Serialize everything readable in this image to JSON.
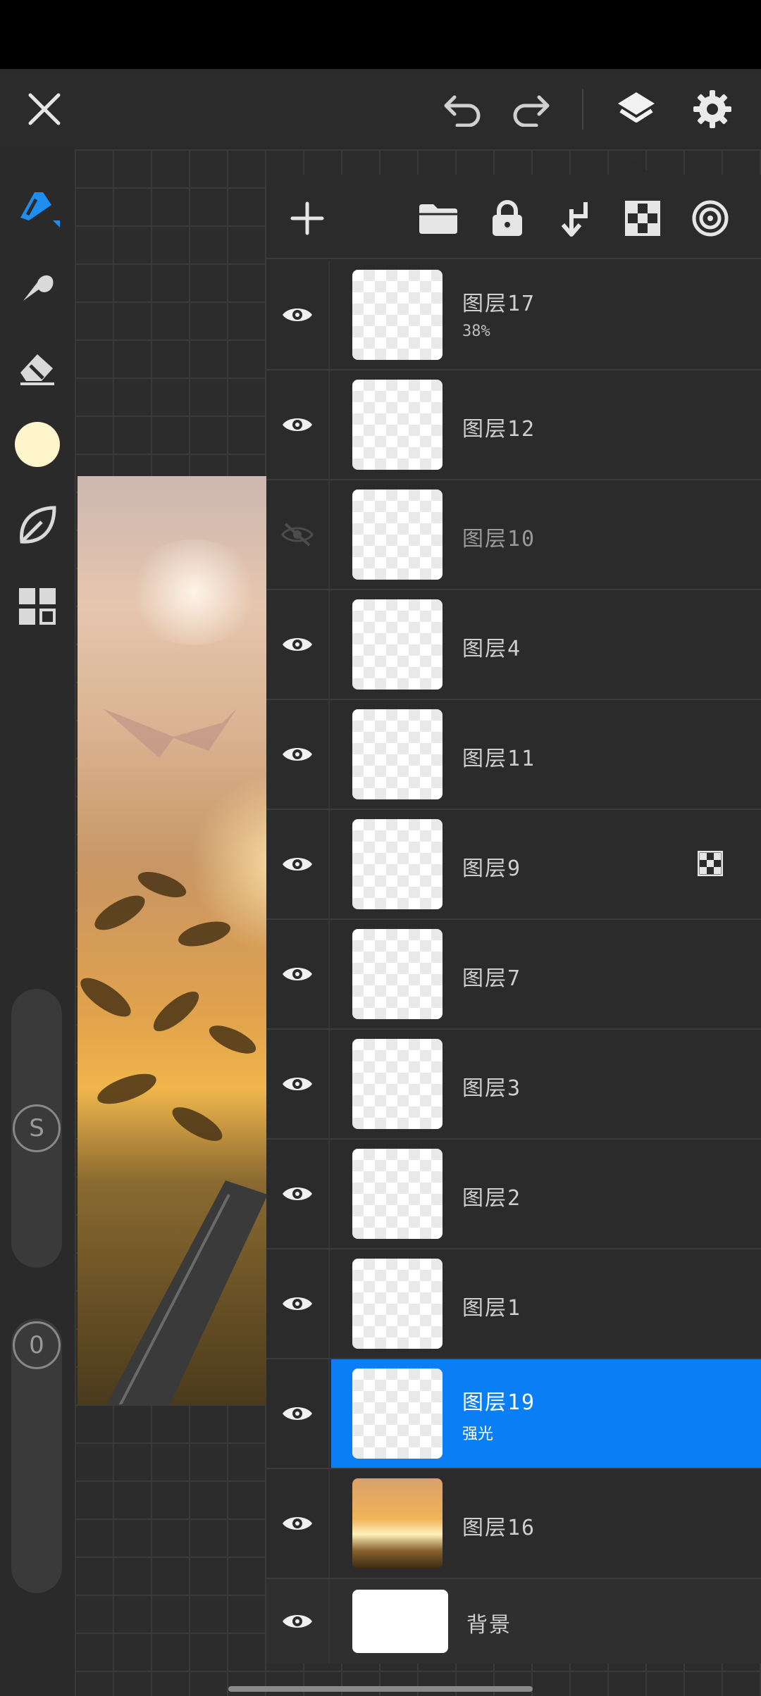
{
  "toolbar": {
    "close_icon": "close-icon",
    "undo_icon": "undo-icon",
    "redo_icon": "redo-icon",
    "layers_icon": "layers-icon",
    "settings_icon": "gear-icon"
  },
  "sidebar": {
    "tools": [
      "brush-tool",
      "smudge-tool",
      "eraser-tool",
      "color-picker",
      "selection-tool",
      "gallery-grid"
    ],
    "active_color": "#fff5cc",
    "size_slider_label": "S",
    "opacity_slider_label": "0"
  },
  "panel_toolbar": {
    "icons": [
      "add-layer-icon",
      "folder-icon",
      "lock-icon",
      "merge-down-icon",
      "alpha-lock-icon",
      "reference-icon"
    ]
  },
  "layers": [
    {
      "name": "图层17",
      "sub": "38%",
      "visible": true
    },
    {
      "name": "图层12",
      "sub": "",
      "visible": true
    },
    {
      "name": "图层10",
      "sub": "",
      "visible": false
    },
    {
      "name": "图层4",
      "sub": "",
      "visible": true
    },
    {
      "name": "图层11",
      "sub": "",
      "visible": true
    },
    {
      "name": "图层9",
      "sub": "",
      "visible": true,
      "alpha_locked": true
    },
    {
      "name": "图层7",
      "sub": "",
      "visible": true
    },
    {
      "name": "图层3",
      "sub": "",
      "visible": true
    },
    {
      "name": "图层2",
      "sub": "",
      "visible": true
    },
    {
      "name": "图层1",
      "sub": "",
      "visible": true
    },
    {
      "name": "图层19",
      "sub": "强光",
      "visible": true,
      "selected": true
    },
    {
      "name": "图层16",
      "sub": "",
      "visible": true
    },
    {
      "name": "背景",
      "sub": "",
      "visible": true
    }
  ],
  "colors": {
    "accent": "#0a7ef5",
    "brush_active": "#1e8ff0",
    "panel": "#2b2b2b"
  }
}
